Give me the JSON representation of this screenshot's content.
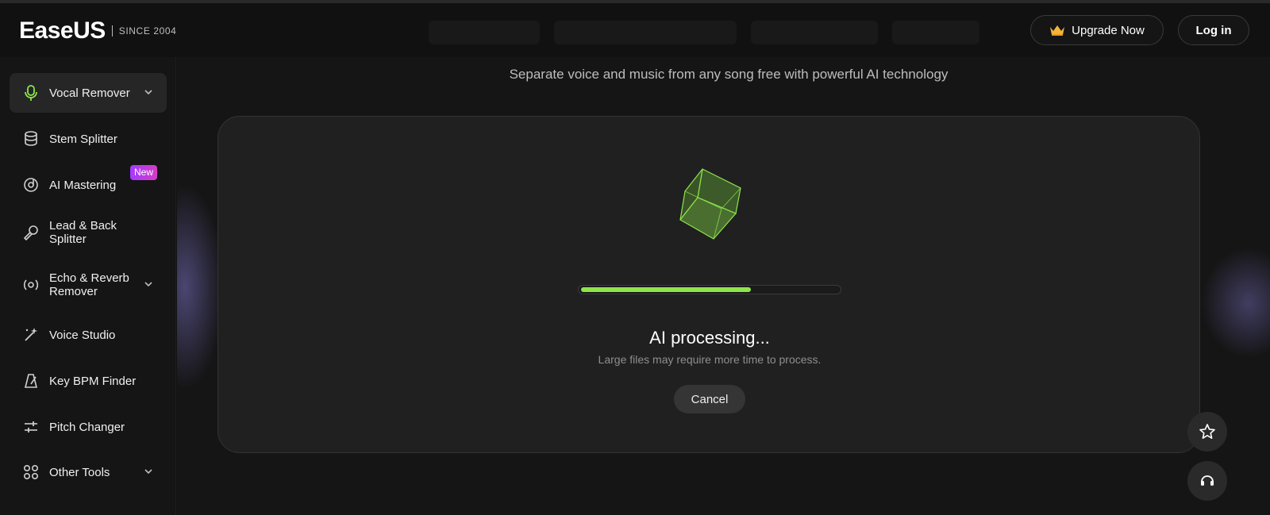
{
  "header": {
    "logo_text": "EaseUS",
    "logo_since": "SINCE 2004",
    "upgrade_label": "Upgrade Now",
    "login_label": "Log in"
  },
  "sidebar": {
    "items": [
      {
        "label": "Vocal Remover",
        "icon": "microphone-icon",
        "active": true,
        "has_dropdown": true
      },
      {
        "label": "Stem Splitter",
        "icon": "cylinder-icon"
      },
      {
        "label": "AI Mastering",
        "icon": "disc-icon",
        "badge": "New"
      },
      {
        "label": "Lead & Back Splitter",
        "icon": "mic-split-icon"
      },
      {
        "label": "Echo & Reverb Remover",
        "icon": "echo-icon",
        "has_dropdown": true
      },
      {
        "label": "Voice Studio",
        "icon": "magic-wand-icon"
      },
      {
        "label": "Key BPM Finder",
        "icon": "metronome-icon"
      },
      {
        "label": "Pitch Changer",
        "icon": "sliders-icon"
      },
      {
        "label": "Other Tools",
        "icon": "grid-icon",
        "has_dropdown": true
      }
    ]
  },
  "main": {
    "subtitle": "Separate voice and music from any song free with powerful AI technology",
    "processing": {
      "title": "AI processing...",
      "subtitle": "Large files may require more time to process.",
      "progress_percent": 66,
      "cancel_label": "Cancel"
    }
  },
  "colors": {
    "accent_green": "#8ee54a",
    "badge_purple": "#a23cff",
    "crown_gold": "#f3b43a"
  },
  "floating": {
    "favorite_icon": "star-icon",
    "support_icon": "headset-icon"
  }
}
